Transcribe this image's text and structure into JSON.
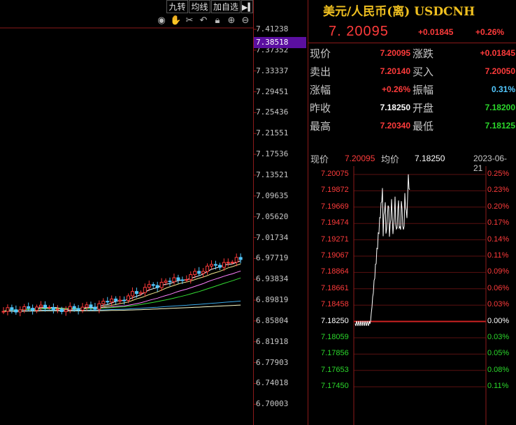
{
  "toolbar": {
    "btn_jiuzhuan": "九转",
    "btn_junxian": "均线",
    "btn_add_watch": "加自选",
    "icons": [
      "eye-icon",
      "hand-icon",
      "scissors-icon",
      "undo-icon",
      "lock-icon",
      "zoom-in-icon",
      "zoom-out-icon"
    ]
  },
  "price_axis": {
    "labels": [
      "7.41238",
      "7.37352",
      "7.33337",
      "7.29451",
      "7.25436",
      "7.21551",
      "7.17536",
      "7.13521",
      "7.09635",
      "7.05620",
      "7.01734",
      "6.97719",
      "6.93834",
      "6.89819",
      "6.85804",
      "6.81918",
      "6.77903",
      "6.74018",
      "6.70003"
    ],
    "current_tag": "7.38518"
  },
  "quote": {
    "title": "美元/人民币(离) USDCNH",
    "price": "7. 20095",
    "change": "+0.01845",
    "change_pct": "+0.26%",
    "rows": [
      {
        "l1": "现价",
        "v1": "7.20095",
        "c1": "red",
        "l2": "涨跌",
        "v2": "+0.01845",
        "c2": "red"
      },
      {
        "l1": "卖出",
        "v1": "7.20140",
        "c1": "red",
        "l2": "买入",
        "v2": "7.20050",
        "c2": "red"
      },
      {
        "l1": "涨幅",
        "v1": "+0.26%",
        "c1": "red",
        "l2": "振幅",
        "v2": "0.31%",
        "c2": "cyan"
      },
      {
        "l1": "昨收",
        "v1": "7.18250",
        "c1": "white",
        "l2": "开盘",
        "v2": "7.18200",
        "c2": "green"
      },
      {
        "l1": "最高",
        "v1": "7.20340",
        "c1": "red",
        "l2": "最低",
        "v2": "7.18125",
        "c2": "green"
      }
    ]
  },
  "intraday": {
    "now_label": "现价",
    "now_value": "7.20095",
    "avg_label": "均价",
    "avg_value": "7.18250",
    "date": "2023-06-21",
    "left_labels": [
      {
        "t": "7.20075",
        "c": "red"
      },
      {
        "t": "7.19872",
        "c": "red"
      },
      {
        "t": "7.19669",
        "c": "red"
      },
      {
        "t": "7.19474",
        "c": "red"
      },
      {
        "t": "7.19271",
        "c": "red"
      },
      {
        "t": "7.19067",
        "c": "red"
      },
      {
        "t": "7.18864",
        "c": "red"
      },
      {
        "t": "7.18661",
        "c": "red"
      },
      {
        "t": "7.18458",
        "c": "red"
      },
      {
        "t": "7.18250",
        "c": "white"
      },
      {
        "t": "7.18059",
        "c": "green"
      },
      {
        "t": "7.17856",
        "c": "green"
      },
      {
        "t": "7.17653",
        "c": "green"
      },
      {
        "t": "7.17450",
        "c": "green"
      }
    ],
    "right_labels": [
      {
        "t": "0.25%",
        "c": "red"
      },
      {
        "t": "0.23%",
        "c": "red"
      },
      {
        "t": "0.20%",
        "c": "red"
      },
      {
        "t": "0.17%",
        "c": "red"
      },
      {
        "t": "0.14%",
        "c": "red"
      },
      {
        "t": "0.11%",
        "c": "red"
      },
      {
        "t": "0.09%",
        "c": "red"
      },
      {
        "t": "0.06%",
        "c": "red"
      },
      {
        "t": "0.03%",
        "c": "red"
      },
      {
        "t": "0.00%",
        "c": "white"
      },
      {
        "t": "0.03%",
        "c": "green"
      },
      {
        "t": "0.05%",
        "c": "green"
      },
      {
        "t": "0.08%",
        "c": "green"
      },
      {
        "t": "0.11%",
        "c": "green"
      }
    ]
  },
  "colors": {
    "up": "#ff3b3b",
    "down": "#52c8ff",
    "grid": "#8b1a1a",
    "ma5": "#ffffff",
    "ma10": "#f0e68c",
    "ma20": "#ff80ff",
    "ma30": "#33dd33",
    "ma60": "#3aa8e8",
    "ma120": "#ffffcc"
  }
}
